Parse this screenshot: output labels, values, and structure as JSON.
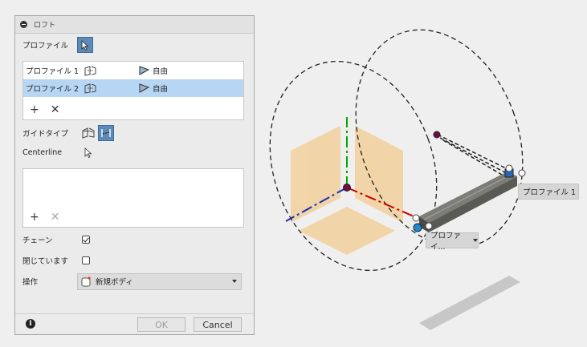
{
  "dialog": {
    "title": "ロフト",
    "profile_label": "プロファイル",
    "profiles": [
      {
        "name": "プロファイル 1",
        "condition": "自由",
        "selected": false
      },
      {
        "name": "プロファイル 2",
        "condition": "自由",
        "selected": true
      }
    ],
    "guide_type_label": "ガイドタイプ",
    "centerline_label": "Centerline",
    "chain_label": "チェーン",
    "chain_checked": true,
    "closed_label": "閉じています",
    "closed_checked": false,
    "operation_label": "操作",
    "operation_value": "新規ボディ",
    "ok_label": "OK",
    "cancel_label": "Cancel"
  },
  "viewport": {
    "profile1_label": "プロファイル 1",
    "profile2_label": "プロファイ..."
  },
  "icons": {
    "collapse": "minus-circle-icon",
    "select": "cursor-arrow-icon",
    "profile_condition": "loft-profile-icon",
    "free_condition": "free-condition-icon",
    "add": "plus-icon",
    "remove": "x-icon",
    "info": "info-icon"
  },
  "colors": {
    "selected_row": "#b7d6f4",
    "active_button": "#5b8bb6",
    "axis_x": "#cc0000",
    "axis_y": "#00aa00",
    "axis_z": "#1a2fb5",
    "origin_plane": "#f2d2a0"
  }
}
